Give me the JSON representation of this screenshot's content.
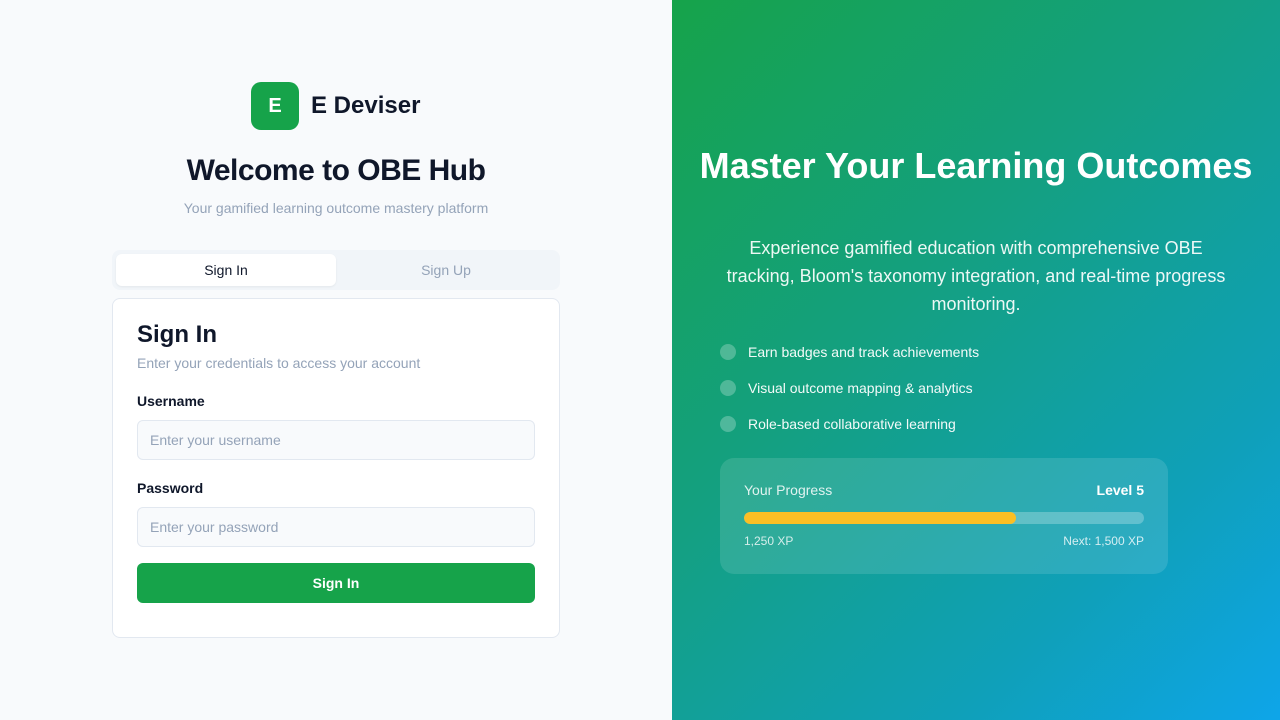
{
  "brand": {
    "logo_letter": "E",
    "name": "E Deviser",
    "color": "#16a34a"
  },
  "welcome": {
    "title": "Welcome to OBE Hub",
    "tagline": "Your gamified learning outcome mastery platform"
  },
  "tabs": [
    {
      "label": "Sign In",
      "active": true
    },
    {
      "label": "Sign Up",
      "active": false
    }
  ],
  "signin_card": {
    "title": "Sign In",
    "subtitle": "Enter your credentials to access your account",
    "username": {
      "label": "Username",
      "placeholder": "Enter your username",
      "value": ""
    },
    "password": {
      "label": "Password",
      "placeholder": "Enter your password",
      "value": ""
    },
    "submit_label": "Sign In"
  },
  "hero": {
    "title": "Master Your Learning Outcomes",
    "description": "Experience gamified education with comprehensive OBE tracking, Bloom's taxonomy integration, and real-time progress monitoring.",
    "features": [
      "Earn badges and track achievements",
      "Visual outcome mapping & analytics",
      "Role-based collaborative learning"
    ]
  },
  "progress": {
    "label": "Your Progress",
    "level": "Level 5",
    "current_xp": "1,250 XP",
    "next_xp": "Next: 1,500 XP",
    "fraction": 0.68,
    "fill_color": "#fbbf24"
  }
}
